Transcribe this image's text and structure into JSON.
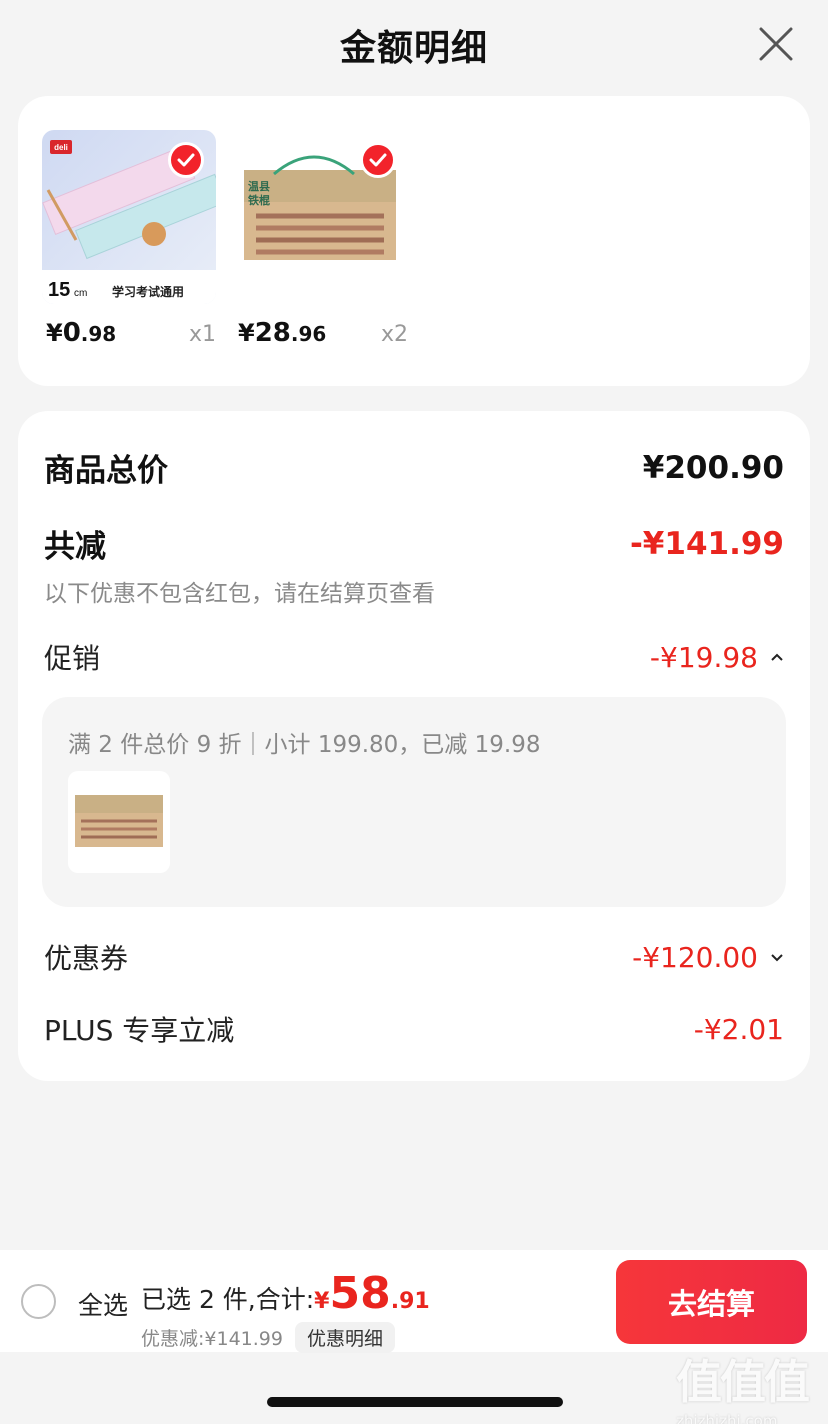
{
  "header": {
    "title": "金额明细",
    "close_icon": "close-icon"
  },
  "products": [
    {
      "price_yen": "¥",
      "price_int": "0",
      "price_dec": ".98",
      "qty": "x1",
      "image_label": "15cm 学习考试通用",
      "brand": "deli"
    },
    {
      "price_yen": "¥",
      "price_int": "28",
      "price_dec": ".96",
      "qty": "x2",
      "image_label": "温县铁棍山药"
    }
  ],
  "detail": {
    "total_label": "商品总价",
    "total_value": "¥200.90",
    "reduce_label": "共减",
    "reduce_value": "-¥141.99",
    "reduce_note": "以下优惠不包含红包，请在结算页查看",
    "promo_label": "促销",
    "promo_value": "-¥19.98",
    "promo_detail": "满 2 件总价 9 折｜小计 199.80，已减 19.98",
    "coupon_label": "优惠券",
    "coupon_value": "-¥120.00",
    "plus_label": "PLUS 专享立减",
    "plus_value": "-¥2.01"
  },
  "bottom": {
    "select_all": "全选",
    "selected_text": "已选 2 件,合计:",
    "total_yen": "¥",
    "total_int": "58",
    "total_dec": ".91",
    "discount_text": "优惠减:¥141.99",
    "discount_detail": "优惠明细",
    "checkout": "去结算"
  },
  "watermark": {
    "glyphs": "值值值",
    "url": "zhizhizhi.com"
  },
  "colors": {
    "accent": "#e9251e",
    "button": "#f6363a",
    "background": "#f4f4f4"
  }
}
